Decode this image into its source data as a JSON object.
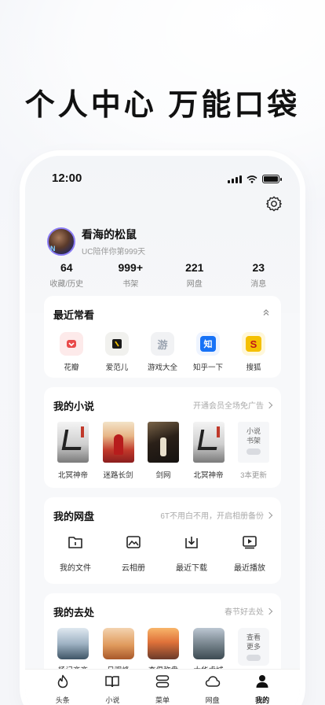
{
  "headline": "个人中心 万能口袋",
  "status": {
    "time": "12:00"
  },
  "profile": {
    "name": "看海的松鼠",
    "subtitle": "UC陪伴你第999天",
    "avatar_badge": "N"
  },
  "stats": [
    {
      "value": "64",
      "label": "收藏/历史"
    },
    {
      "value": "999+",
      "label": "书架"
    },
    {
      "value": "221",
      "label": "网盘"
    },
    {
      "value": "23",
      "label": "消息"
    }
  ],
  "recent": {
    "title": "最近常看",
    "apps": [
      {
        "label": "花瓣",
        "icon": "huaban-icon",
        "color": "#e94a4a"
      },
      {
        "label": "爱范儿",
        "icon": "ifanr-icon",
        "color": "#1a1a1a"
      },
      {
        "label": "游戏大全",
        "icon": "game-icon",
        "glyph": "游",
        "color": "#9aa3b0"
      },
      {
        "label": "知乎一下",
        "icon": "zhihu-icon",
        "glyph": "知",
        "color": "#1772f6"
      },
      {
        "label": "搜狐",
        "icon": "sohu-icon",
        "glyph": "S",
        "color": "#f5c000"
      }
    ]
  },
  "novels": {
    "title": "我的小说",
    "promo": "开通会员全场免广告",
    "books": [
      {
        "title": "北冥神帝"
      },
      {
        "title": "迷路长剑"
      },
      {
        "title": "剑网"
      },
      {
        "title": "北冥神帝"
      }
    ],
    "shelf": {
      "line1": "小说",
      "line2": "书架",
      "updates": "3本更新"
    }
  },
  "netdisk": {
    "title": "我的网盘",
    "promo": "6T不用白不用，开启相册备份",
    "items": [
      {
        "label": "我的文件",
        "icon": "folder-icon"
      },
      {
        "label": "云相册",
        "icon": "album-icon"
      },
      {
        "label": "最近下载",
        "icon": "download-icon"
      },
      {
        "label": "最近播放",
        "icon": "play-icon"
      }
    ]
  },
  "places": {
    "title": "我的去处",
    "promo": "春节好去处",
    "items": [
      {
        "label": "杨记齐齐"
      },
      {
        "label": "日观峰"
      },
      {
        "label": "李俱称盘"
      },
      {
        "label": "大华虎城"
      }
    ],
    "more": {
      "line1": "查看",
      "line2": "更多"
    }
  },
  "tabs": [
    {
      "label": "头条",
      "icon": "fire-icon"
    },
    {
      "label": "小说",
      "icon": "book-icon"
    },
    {
      "label": "菜单",
      "icon": "menu-icon"
    },
    {
      "label": "网盘",
      "icon": "cloud-icon"
    },
    {
      "label": "我的",
      "icon": "user-icon",
      "active": true
    }
  ]
}
